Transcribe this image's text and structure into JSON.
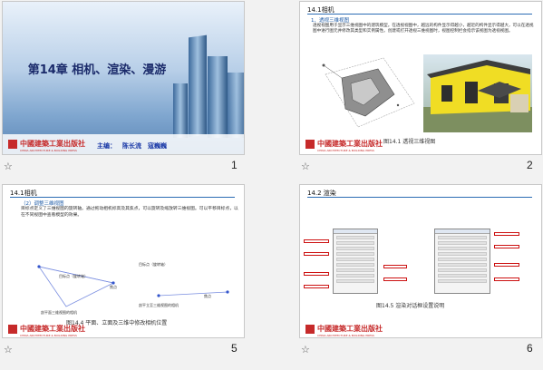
{
  "slides": [
    {
      "number": "1",
      "title": "第14章 相机、渲染、漫游",
      "authors_label": "主编：",
      "authors": "陈长流　寇巍巍",
      "publisher_cn": "中國建築工業出版社",
      "publisher_en": "CHINA ARCHITECTURE & BUILDING PRESS"
    },
    {
      "number": "2",
      "header": "14.1相机",
      "subtitle": "1、透视三维视图",
      "paragraph": "透视视图用于显示三维视图中的建筑模型。在透视视图中，越远的构件显示得越小，越近的构件显示得越大，可以在透视图中进行图元并修改其类型和实例属性。创建或打开透视三维视图时，视图控制栏会指示该视图为透视视图。",
      "caption": "图14.1 透视三维视图",
      "publisher_cn": "中國建築工業出版社",
      "publisher_en": "CHINA ARCHITECTURE & BUILDING PRESS"
    },
    {
      "number": "5",
      "header": "14.1相机",
      "subtitle": "（2）调整三维视图",
      "paragraph": "目标点定义了三维视图的旋转轴。通过拖动相机标高及其焦点，可以旋转及缩放转三维视图。可以平移目标点，以在不同视图中查看模型的效果。",
      "label_target_left": "目标点（旋转轴）",
      "label_focus_left": "焦点",
      "label_target_right": "目标点（旋转轴）",
      "label_focus_right": "焦点",
      "label_plan": "剖平面三维视图的相机",
      "label_elev": "剖平立至三维视图的相机",
      "caption": "图14.4 平面、立面及三维中修改相机位置",
      "publisher_cn": "中國建築工業出版社",
      "publisher_en": "CHINA ARCHITECTURE & BUILDING PRESS"
    },
    {
      "number": "6",
      "header": "14.2  渲染",
      "caption": "图14.5 渲染对话框设置说明",
      "publisher_cn": "中國建築工業出版社",
      "publisher_en": "CHINA ARCHITECTURE & BUILDING PRESS"
    }
  ],
  "star_glyph": "☆"
}
